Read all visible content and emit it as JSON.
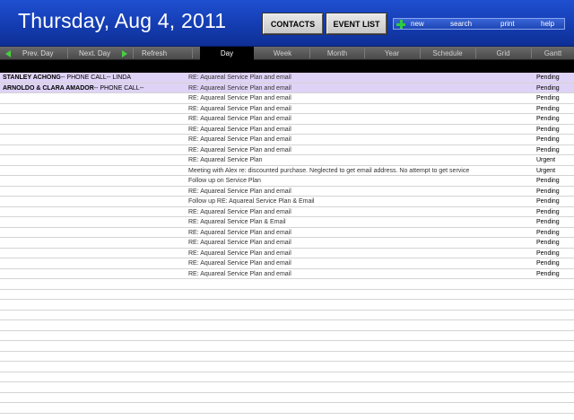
{
  "header": {
    "date_title": "Thursday, Aug 4, 2011",
    "contacts_label": "CONTACTS",
    "eventlist_label": "EVENT LIST",
    "actions": {
      "new": "new",
      "search": "search",
      "print": "print",
      "help": "help"
    }
  },
  "nav": {
    "prev_day": "Prev. Day",
    "next_day": "Next. Day",
    "refresh": "Refresh",
    "tabs": [
      "Day",
      "Week",
      "Month",
      "Year",
      "Schedule",
      "Grid",
      "Gantt"
    ],
    "active_tab": "Day"
  },
  "colors": {
    "header_blue": "#1640b8",
    "highlight_row": "#ded3f6",
    "nav_arrow": "#46d040"
  },
  "events": [
    {
      "contact_bold": "STANLEY ACHONG",
      "contact_rest": "-- PHONE CALL-- LINDA",
      "subject": "RE: Aquareal Service Plan and email",
      "status": "Pending",
      "highlight": true
    },
    {
      "contact_bold": "ARNOLDO & CLARA AMADOR",
      "contact_rest": "-- PHONE CALL--",
      "subject": "RE: Aquareal Service Plan and email",
      "status": "Pending",
      "highlight": true
    },
    {
      "contact_bold": "",
      "contact_rest": "",
      "subject": "RE: Aquareal Service Plan and email",
      "status": "Pending"
    },
    {
      "contact_bold": "",
      "contact_rest": "",
      "subject": "RE: Aquareal Service Plan and email",
      "status": "Pending"
    },
    {
      "contact_bold": "",
      "contact_rest": "",
      "subject": "RE: Aquareal Service Plan and email",
      "status": "Pending"
    },
    {
      "contact_bold": "",
      "contact_rest": "",
      "subject": "RE: Aquareal Service Plan and email",
      "status": "Pending"
    },
    {
      "contact_bold": "",
      "contact_rest": "",
      "subject": "RE: Aquareal Service Plan and email",
      "status": "Pending"
    },
    {
      "contact_bold": "",
      "contact_rest": "",
      "subject": "RE: Aquareal Service Plan and email",
      "status": "Pending"
    },
    {
      "contact_bold": "",
      "contact_rest": "",
      "subject": "RE: Aquareal Service Plan",
      "status": "Urgent"
    },
    {
      "contact_bold": "",
      "contact_rest": "",
      "subject": "Meeting with Alex re: discounted purchase. Neglected to get email address. No attempt to get service",
      "status": "Urgent"
    },
    {
      "contact_bold": "",
      "contact_rest": "",
      "subject": "Follow up on Service Plan",
      "status": "Pending"
    },
    {
      "contact_bold": "",
      "contact_rest": "",
      "subject": "RE: Aquareal Service Plan and email",
      "status": "Pending"
    },
    {
      "contact_bold": "",
      "contact_rest": "",
      "subject": "Follow up RE: Aquareal Service Plan & Email",
      "status": "Pending"
    },
    {
      "contact_bold": "",
      "contact_rest": "",
      "subject": "RE: Aquareal Service Plan and email",
      "status": "Pending"
    },
    {
      "contact_bold": "",
      "contact_rest": "",
      "subject": "RE: Aquareal Service Plan & Email",
      "status": "Pending"
    },
    {
      "contact_bold": "",
      "contact_rest": "",
      "subject": "RE: Aquareal Service Plan and email",
      "status": "Pending"
    },
    {
      "contact_bold": "",
      "contact_rest": "",
      "subject": "RE: Aquareal Service Plan and email",
      "status": "Pending"
    },
    {
      "contact_bold": "",
      "contact_rest": "",
      "subject": "RE: Aquareal Service Plan and email",
      "status": "Pending"
    },
    {
      "contact_bold": "",
      "contact_rest": "",
      "subject": "RE: Aquareal Service Plan and email",
      "status": "Pending"
    },
    {
      "contact_bold": "",
      "contact_rest": "",
      "subject": "RE: Aquareal Service Plan and email",
      "status": "Pending"
    }
  ]
}
